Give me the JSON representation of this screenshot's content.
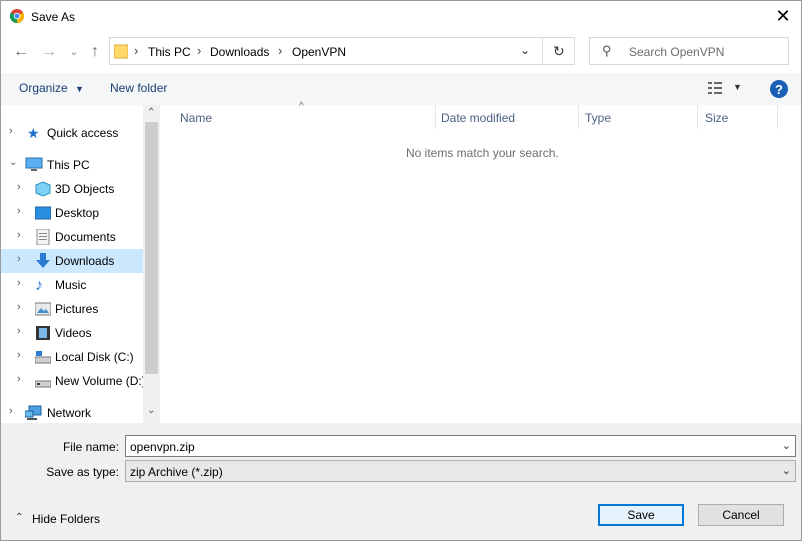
{
  "window": {
    "title": "Save As"
  },
  "address": {
    "crumbs": [
      "This PC",
      "Downloads",
      "OpenVPN"
    ]
  },
  "search": {
    "placeholder": "Search OpenVPN"
  },
  "toolbar": {
    "organize_label": "Organize",
    "new_folder_label": "New folder"
  },
  "nav": {
    "items": [
      {
        "label": "Quick access"
      },
      {
        "label": "This PC"
      },
      {
        "label": "3D Objects"
      },
      {
        "label": "Desktop"
      },
      {
        "label": "Documents"
      },
      {
        "label": "Downloads"
      },
      {
        "label": "Music"
      },
      {
        "label": "Pictures"
      },
      {
        "label": "Videos"
      },
      {
        "label": "Local Disk (C:)"
      },
      {
        "label": "New Volume (D:)"
      },
      {
        "label": "Network"
      }
    ]
  },
  "files": {
    "columns": [
      "Name",
      "Date modified",
      "Type",
      "Size"
    ],
    "empty_message": "No items match your search."
  },
  "form": {
    "file_name_label": "File name:",
    "file_name_value": "openvpn.zip",
    "save_type_label": "Save as type:",
    "save_type_value": "zip Archive (*.zip)"
  },
  "footer": {
    "hide_folders_label": "Hide Folders",
    "save_label": "Save",
    "cancel_label": "Cancel"
  },
  "colors": {
    "accent": "#0078d7",
    "selection": "#cce8ff",
    "help": "#1a5fb4"
  }
}
